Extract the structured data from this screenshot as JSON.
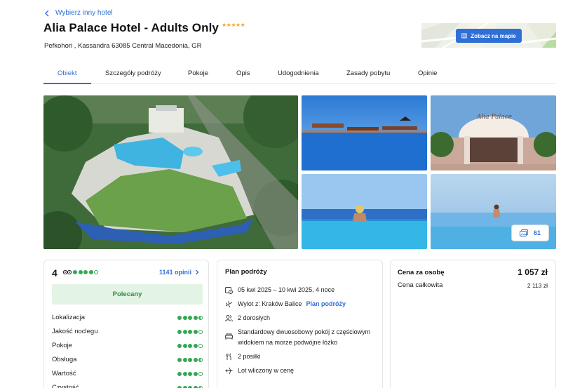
{
  "header": {
    "back_label": "Wybierz inny hotel",
    "hotel_name": "Alia Palace Hotel - Adults Only",
    "stars": "★★★★★",
    "address": "Pefkohori , Kassandra 63085 Central Macedonia, GR",
    "map_button": "Zobacz na mapie"
  },
  "tabs": [
    "Obiekt",
    "Szczegóły podróży",
    "Pokoje",
    "Opis",
    "Udogodnienia",
    "Zasady pobytu",
    "Opinie"
  ],
  "gallery": {
    "count": "61"
  },
  "reviews": {
    "score": "4",
    "score_level": 4,
    "count_link": "1141 opinii",
    "badge": "Polecany",
    "categories": [
      {
        "label": "Lokalizacja",
        "level": 4.5
      },
      {
        "label": "Jakość noclegu",
        "level": 4
      },
      {
        "label": "Pokoje",
        "level": 4
      },
      {
        "label": "Obsługa",
        "level": 4.5
      },
      {
        "label": "Wartość",
        "level": 4
      },
      {
        "label": "Czystość",
        "level": 4.5
      }
    ]
  },
  "plan": {
    "title": "Plan podróży",
    "dates": "05 kwi 2025 – 10 kwi 2025, 4 noce",
    "departure": "Wylot z: Kraków Balice",
    "departure_link": "Plan podróży",
    "guests": "2 dorosłych",
    "room_line1": "Standardowy dwuosobowy pokój z częściowym",
    "room_line2": "widokiem na morze podwójne łóżko",
    "meals": "2 posiłki",
    "flight": "Lot wliczony w cenę"
  },
  "price": {
    "per_person_label": "Cena za osobę",
    "per_person_value": "1 057 zł",
    "total_label": "Cena całkowita",
    "total_value": "2 113 zł"
  },
  "colors": {
    "accent": "#2f6fd6",
    "green": "#34a853",
    "stars": "#f5a623"
  }
}
